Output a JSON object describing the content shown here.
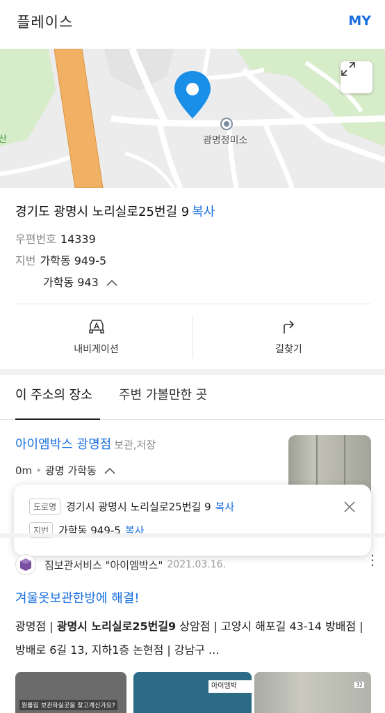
{
  "header": {
    "title": "플레이스",
    "my_label": "MY"
  },
  "map": {
    "place_label": "광명정미소",
    "edge_label": "산",
    "colors": {
      "background": "#ececec",
      "park": "#d7ecc9",
      "highway": "#f1b165",
      "road": "#ffffff",
      "pin": "#1a8fe8"
    }
  },
  "address": {
    "road": "경기도 광명시 노리실로25번길 9",
    "copy_label": "복사",
    "postal_label": "우편번호",
    "postal_code": "14339",
    "lot_label": "지번",
    "lot_1": "가학동 949-5",
    "lot_2": "가학동 943"
  },
  "actions": {
    "navigation": "내비게이션",
    "directions": "길찾기"
  },
  "tabs": {
    "this_address": "이 주소의 장소",
    "nearby": "주변 가볼만한 곳"
  },
  "place": {
    "name": "아이엠박스 광명점",
    "category": "보관,저장",
    "distance": "0m",
    "area": "광명 가학동"
  },
  "popup": {
    "road_badge": "도로명",
    "road_address": "경기시 광명시 노리실로25번길 9",
    "lot_badge": "지번",
    "lot_address": "가학동 949-5",
    "copy_label": "복사"
  },
  "blog": {
    "source": "짐보관서비스 \"아이엠박스\"",
    "date": "2021.03.16.",
    "title": "겨울옷보관한방에 해결!",
    "body_pre": "광명점 | ",
    "body_bold": "광명시 노리실로25번길9",
    "body_post": " 상암점 | 고양시 해포길 43-14 방배점 | 방배로 6길 13, 지하1층 논현점 | 강남구 ...",
    "thumb1_caption": "원룸짐 보관하실곳을 찾고계신가요?",
    "thumb2_sign": "아이엠박",
    "thumb3_number": "32"
  }
}
